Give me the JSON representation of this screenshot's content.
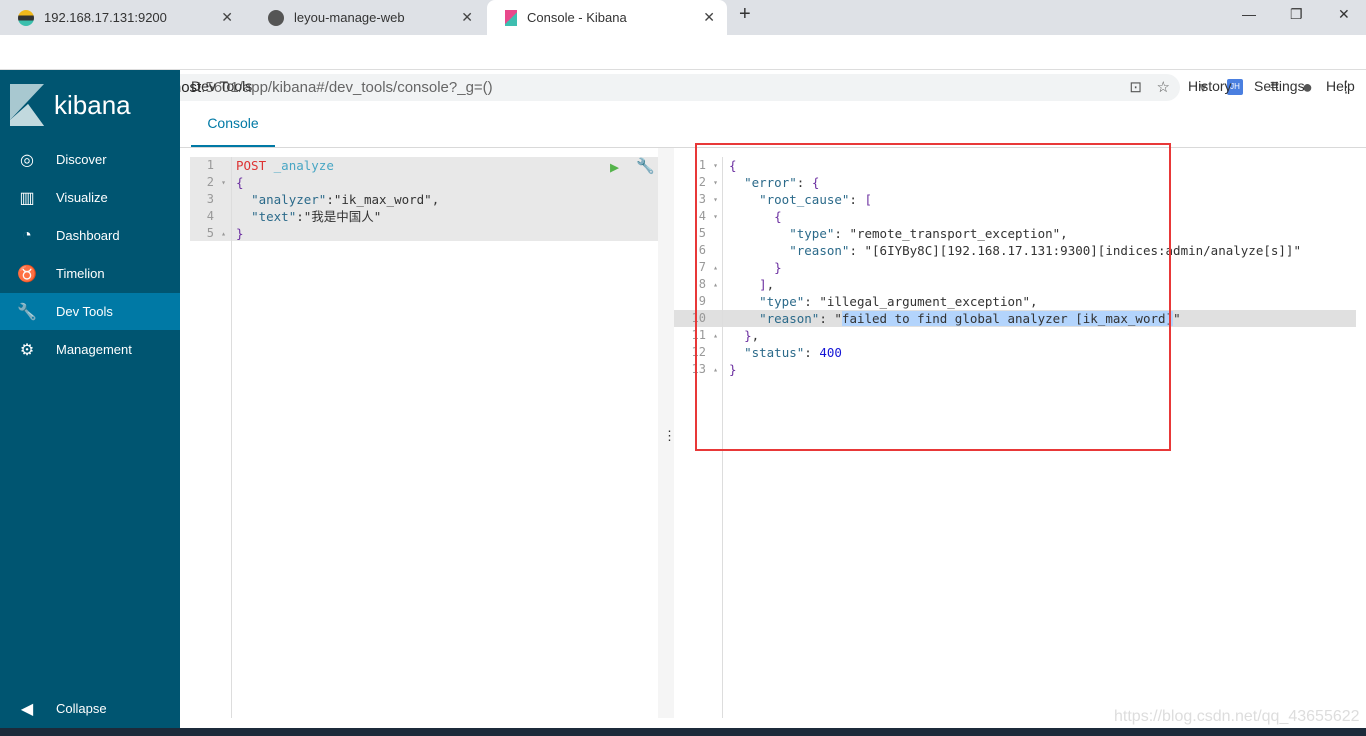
{
  "browser": {
    "tabs": [
      {
        "title": "192.168.17.131:9200",
        "icon": "elastic-icon"
      },
      {
        "title": "leyou-manage-web",
        "icon": "globe-icon"
      },
      {
        "title": "Console - Kibana",
        "icon": "kibana-icon",
        "active": true
      }
    ],
    "url_host": "localhost",
    "url_rest": ":5601/app/kibana#/dev_tools/console?_g=()",
    "ext_badge": "JH"
  },
  "sidebar": {
    "logo": "kibana",
    "items": [
      {
        "label": "Discover",
        "icon": "compass-icon"
      },
      {
        "label": "Visualize",
        "icon": "bar-chart-icon"
      },
      {
        "label": "Dashboard",
        "icon": "dashboard-icon"
      },
      {
        "label": "Timelion",
        "icon": "timelion-icon"
      },
      {
        "label": "Dev Tools",
        "icon": "wrench-icon",
        "active": true
      },
      {
        "label": "Management",
        "icon": "gear-icon"
      }
    ],
    "collapse": "Collapse"
  },
  "header": {
    "title": "Dev Tools",
    "links": [
      "History",
      "Settings",
      "Help"
    ],
    "tab": "Console"
  },
  "request": {
    "line_numbers": [
      "1",
      "2",
      "3",
      "4",
      "5"
    ],
    "method": "POST",
    "path": "_analyze",
    "lines": [
      "{",
      "  \"analyzer\":\"ik_max_word\",",
      "  \"text\":\"我是中国人\"",
      "}"
    ]
  },
  "response": {
    "line_numbers": [
      "1",
      "2",
      "3",
      "4",
      "5",
      "6",
      "7",
      "8",
      "9",
      "10",
      "11",
      "12",
      "13"
    ],
    "lines": [
      "{",
      "  \"error\": {",
      "    \"root_cause\": [",
      "      {",
      "        \"type\": \"remote_transport_exception\",",
      "        \"reason\": \"[6IYBy8C][192.168.17.131:9300][indices:admin/analyze[s]]\"",
      "      }",
      "    ],",
      "    \"type\": \"illegal_argument_exception\",",
      "    \"reason\": \"failed to find global analyzer [ik_max_word]\"",
      "  },",
      "  \"status\": 400",
      "}"
    ]
  },
  "watermark": "https://blog.csdn.net/qq_43655622",
  "colors": {
    "sidebar": "#005571",
    "active": "#0079a5",
    "highlight_box": "#e83838"
  }
}
